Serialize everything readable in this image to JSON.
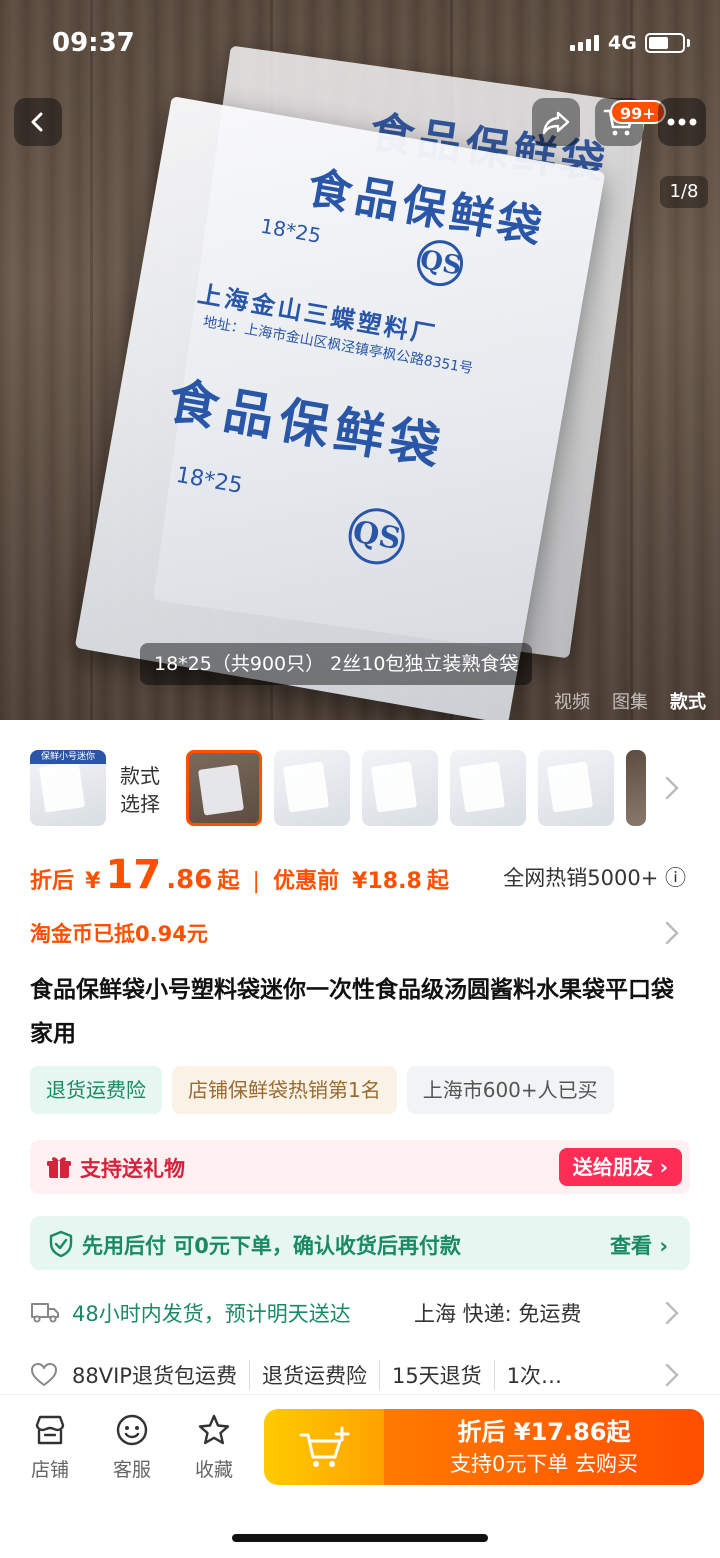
{
  "status_bar": {
    "time": "09:37",
    "network": "4G"
  },
  "top_nav": {
    "cart_badge": "99+",
    "page_indicator": "1/8"
  },
  "hero": {
    "caption": "18*25（共900只） 2丝10包独立装熟食袋",
    "media_tabs": [
      "视频",
      "图集",
      "款式"
    ],
    "active_media_tab": "款式",
    "bag_print": {
      "title": "食品保鲜袋",
      "size": "18*25",
      "maker": "上海金山三蝶塑料厂",
      "address": "地址：上海市金山区枫泾镇亭枫公路8351号",
      "logo_letters": "QS"
    }
  },
  "style_selector": {
    "label_line1": "款式",
    "label_line2": "选择",
    "first_thumb_label": "保鲜小号迷你"
  },
  "price": {
    "after_discount_label": "折后",
    "currency": "¥",
    "price_int": "17",
    "price_dec": ".86",
    "price_suffix": "起",
    "divider": "|",
    "before_label": "优惠前",
    "before_price": "¥18.8",
    "before_suffix": "起",
    "sales": "全网热销5000+",
    "info_icon": "ⓘ"
  },
  "coins": {
    "text": "淘金币已抵0.94元"
  },
  "title": "食品保鲜袋小号塑料袋迷你一次性食品级汤圆酱料水果袋平口袋家用",
  "tags": [
    "退货运费险",
    "店铺保鲜袋热销第1名",
    "上海市600+人已买"
  ],
  "gift": {
    "text": "支持送礼物",
    "button": "送给朋友 ›"
  },
  "pay_later": {
    "text": "先用后付 可0元下单，确认收货后再付款",
    "link": "查看 ›"
  },
  "shipping": {
    "text": "48小时内发货，预计明天送达",
    "location": "上海  快递: 免运费"
  },
  "service": {
    "items": [
      "88VIP退货包运费",
      "退货运费险",
      "15天退货",
      "1次…"
    ]
  },
  "bottom_bar": {
    "shop": "店铺",
    "customer_service": "客服",
    "favorite": "收藏",
    "buy_line1": "折后 ¥17.86起",
    "buy_line2": "支持0元下单  去购买"
  },
  "colors": {
    "accent": "#ff5000",
    "green": "#1a8a64",
    "gift_red": "#ff2c55"
  },
  "icons": [
    "back-icon",
    "share-icon",
    "cart-icon",
    "more-icon",
    "gift-icon",
    "shield-check-icon",
    "truck-icon",
    "heart-icon",
    "shop-icon",
    "service-icon",
    "star-icon",
    "cart-plus-icon",
    "chevron-right-icon"
  ]
}
